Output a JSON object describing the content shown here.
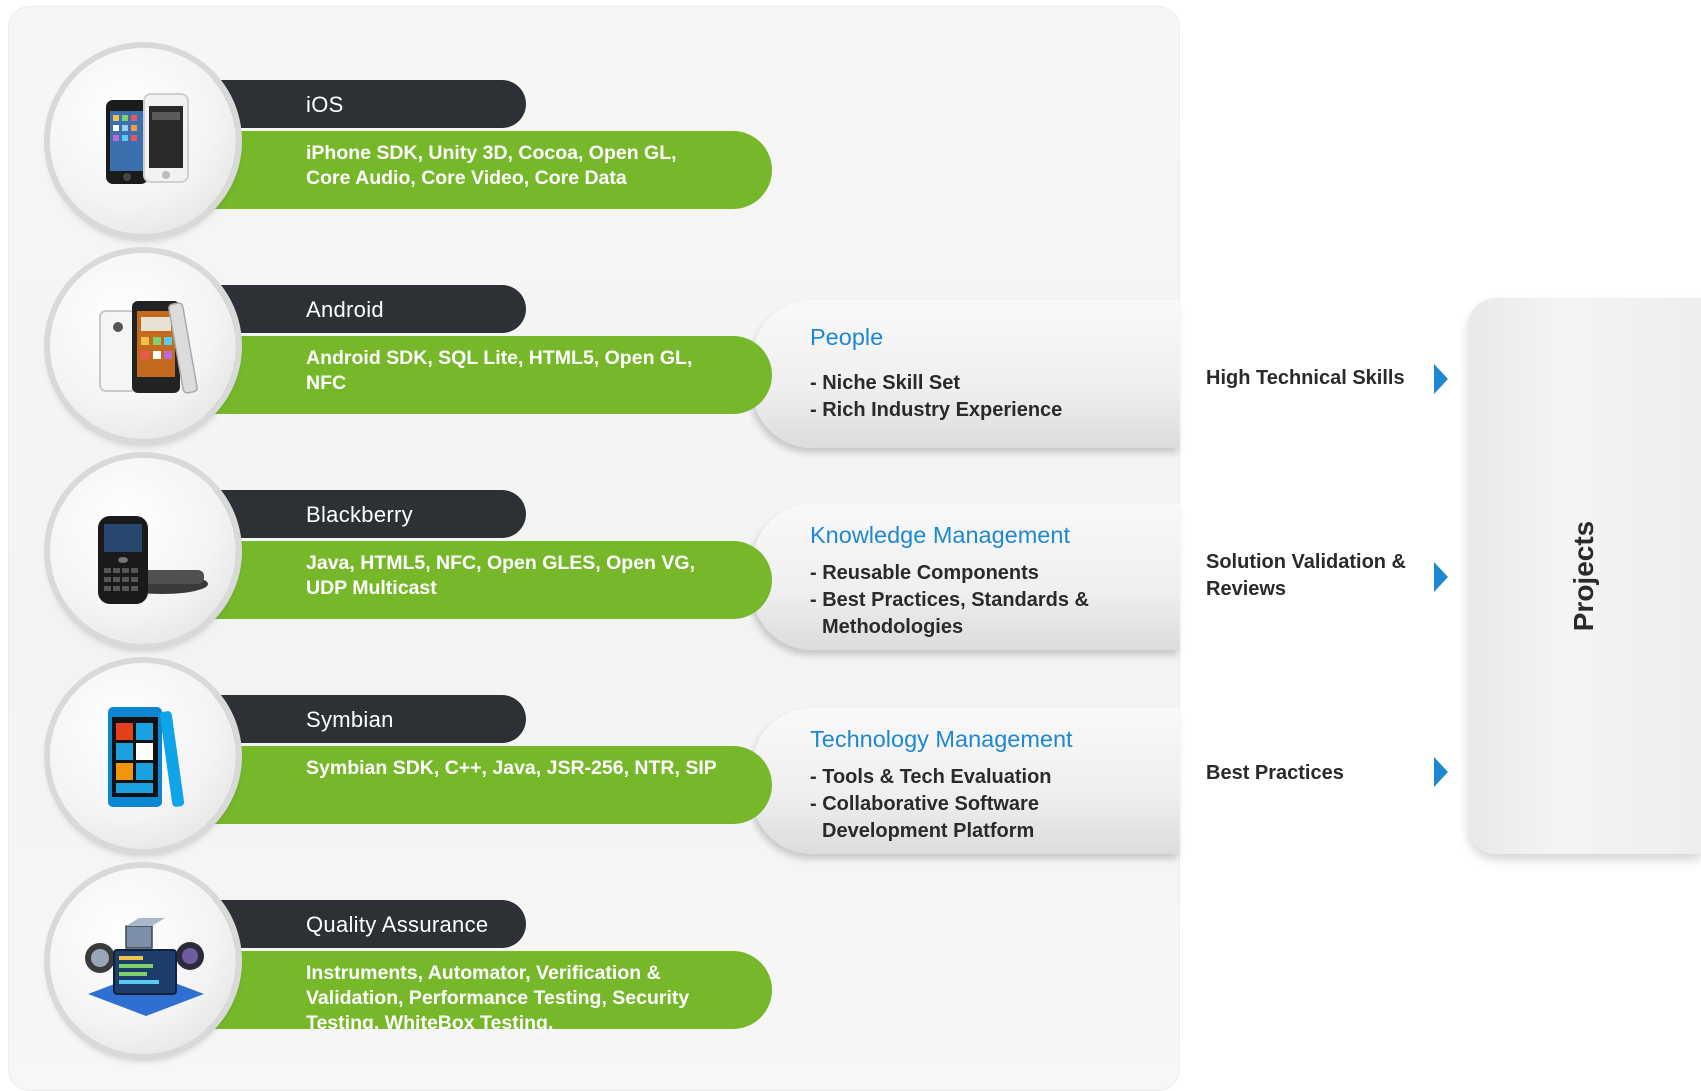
{
  "platforms": [
    {
      "name": "iOS",
      "technologies": "iPhone SDK, Unity 3D, Cocoa, Open GL, Core Audio, Core Video, Core Data",
      "icon": "iphone-icon"
    },
    {
      "name": "Android",
      "technologies": "Android SDK, SQL Lite, HTML5, Open GL, NFC",
      "icon": "android-phone-icon"
    },
    {
      "name": "Blackberry",
      "technologies": "Java, HTML5, NFC, Open GLES, Open VG, UDP Multicast",
      "icon": "blackberry-phone-icon"
    },
    {
      "name": "Symbian",
      "technologies": "Symbian SDK, C++, Java,  JSR-256, NTR, SIP",
      "icon": "nokia-phone-icon"
    },
    {
      "name": "Quality Assurance",
      "technologies": "Instruments, Automator, Verification & Validation, Performance Testing, Security Testing, WhiteBox Testing.",
      "icon": "qa-tools-icon"
    }
  ],
  "capabilities": [
    {
      "heading": "People",
      "points": [
        "- Niche Skill Set",
        "- Rich Industry Experience"
      ]
    },
    {
      "heading": "Knowledge Management",
      "points": [
        "- Reusable Components",
        "- Best Practices, Standards & Methodologies"
      ]
    },
    {
      "heading": "Technology Management",
      "points": [
        "- Tools & Tech Evaluation",
        "- Collaborative Software Development Platform"
      ]
    }
  ],
  "outcomes": [
    "High Technical Skills",
    "Solution Validation & Reviews",
    "Best Practices"
  ],
  "projects_label": "Projects",
  "colors": {
    "green": "#76b82a",
    "dark": "#2d3135",
    "blue": "#1e88d0"
  }
}
